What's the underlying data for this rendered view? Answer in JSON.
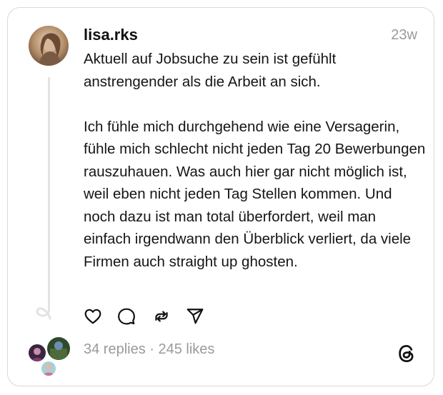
{
  "post": {
    "username": "lisa.rks",
    "time": "23w",
    "text": "Aktuell auf Jobsuche zu sein ist gefühlt anstrengender als die Arbeit an sich.\n\nIch fühle mich durchgehend wie eine Versagerin, fühle mich schlecht nicht jeden Tag 20 Bewerbungen rauszuhauen. Was auch hier gar nicht möglich ist, weil eben nicht jeden Tag Stellen kommen. Und noch dazu ist man total überfordert, weil man einfach irgendwann den Überblick verliert, da viele Firmen auch straight up ghosten."
  },
  "actions": {
    "like": "heart-icon",
    "reply": "comment-icon",
    "repost": "repost-icon",
    "share": "send-icon"
  },
  "footer": {
    "stats": "34 replies · 245 likes",
    "logo": "threads-logo-icon"
  },
  "colors": {
    "text": "#151515",
    "muted": "#9a9a9a",
    "border": "#d9d9d9"
  }
}
